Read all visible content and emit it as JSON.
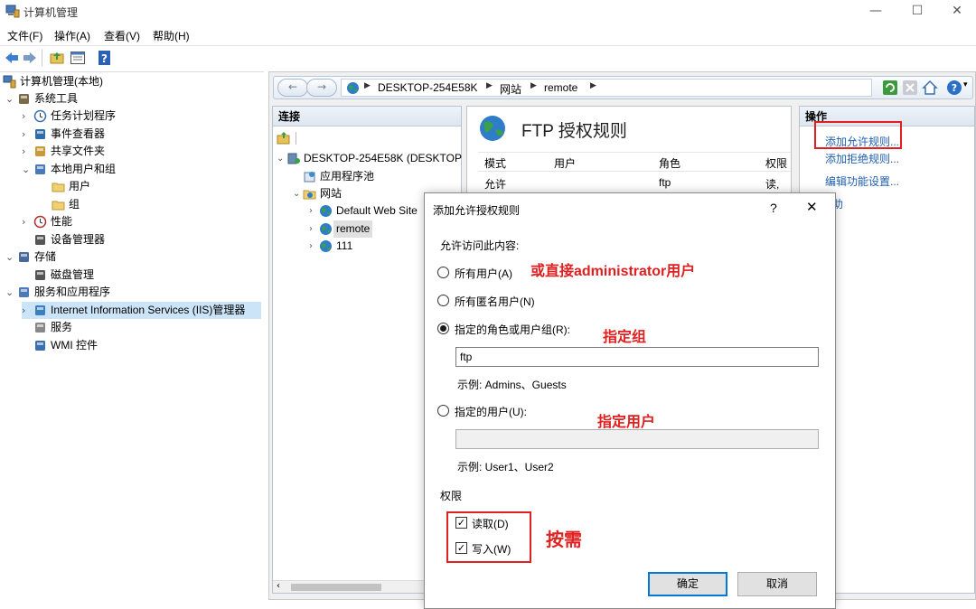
{
  "window": {
    "title": "计算机管理",
    "minimize": "—",
    "maximize": "☐",
    "close": "✕"
  },
  "menu": [
    "文件(F)",
    "操作(A)",
    "查看(V)",
    "帮助(H)"
  ],
  "toolbar_icons": [
    "back-arrow-icon",
    "forward-arrow-icon",
    "folder-up-icon",
    "properties-icon",
    "help-icon"
  ],
  "left_tree": {
    "root": "计算机管理(本地)",
    "items": [
      {
        "label": "系统工具",
        "icon": "tools-icon",
        "caret": "⌄"
      },
      {
        "label": "任务计划程序",
        "icon": "clock-icon",
        "caret": "›"
      },
      {
        "label": "事件查看器",
        "icon": "event-viewer-icon",
        "caret": "›"
      },
      {
        "label": "共享文件夹",
        "icon": "shared-folder-icon",
        "caret": "›"
      },
      {
        "label": "本地用户和组",
        "icon": "users-icon",
        "caret": "⌄"
      },
      {
        "label": "用户",
        "icon": "folder-icon",
        "caret": ""
      },
      {
        "label": "组",
        "icon": "folder-icon",
        "caret": ""
      },
      {
        "label": "性能",
        "icon": "performance-icon",
        "caret": "›"
      },
      {
        "label": "设备管理器",
        "icon": "device-manager-icon",
        "caret": ""
      },
      {
        "label": "存储",
        "icon": "storage-icon",
        "caret": "⌄"
      },
      {
        "label": "磁盘管理",
        "icon": "disk-icon",
        "caret": ""
      },
      {
        "label": "服务和应用程序",
        "icon": "services-apps-icon",
        "caret": "⌄"
      },
      {
        "label": "Internet Information Services (IIS)管理器",
        "icon": "iis-icon",
        "caret": "›"
      },
      {
        "label": "服务",
        "icon": "gear-icon",
        "caret": ""
      },
      {
        "label": "WMI 控件",
        "icon": "wmi-icon",
        "caret": ""
      }
    ]
  },
  "iis": {
    "address": {
      "back": "←",
      "forward": "→",
      "crumbs": [
        "DESKTOP-254E58K",
        "网站",
        "remote"
      ],
      "sep": "▶"
    },
    "connections": {
      "header": "连接",
      "tree": [
        {
          "label": "DESKTOP-254E58K (DESKTOP",
          "caret": "⌄",
          "icon": "server-icon"
        },
        {
          "label": "应用程序池",
          "caret": "",
          "icon": "app-pool-icon"
        },
        {
          "label": "网站",
          "caret": "⌄",
          "icon": "sites-folder-icon"
        },
        {
          "label": "Default Web Site",
          "caret": "›",
          "icon": "globe-icon"
        },
        {
          "label": "remote",
          "caret": "›",
          "icon": "globe-icon"
        },
        {
          "label": "111",
          "caret": "›",
          "icon": "globe-icon"
        }
      ]
    },
    "feature": {
      "title": "FTP 授权规则",
      "columns": [
        "模式",
        "用户",
        "角色",
        "权限"
      ],
      "rows": [
        {
          "mode": "允许",
          "user": "",
          "role": "ftp",
          "perm": "读,"
        }
      ]
    },
    "actions": {
      "header": "操作",
      "links": [
        "添加允许规则...",
        "添加拒绝规则...",
        "编辑功能设置...",
        "帮助"
      ]
    }
  },
  "dialog": {
    "title": "添加允许授权规则",
    "help": "?",
    "close": "✕",
    "prompt": "允许访问此内容:",
    "options": [
      {
        "label": "所有用户(A)",
        "checked": false
      },
      {
        "label": "所有匿名用户(N)",
        "checked": false
      },
      {
        "label": "指定的角色或用户组(R):",
        "checked": true
      },
      {
        "label": "指定的用户(U):",
        "checked": false
      }
    ],
    "role_value": "ftp",
    "role_example": "示例: Admins、Guests",
    "user_value": "",
    "user_example": "示例: User1、User2",
    "permissions_label": "权限",
    "permissions": [
      {
        "label": "读取(D)",
        "checked": true
      },
      {
        "label": "写入(W)",
        "checked": true
      }
    ],
    "ok": "确定",
    "cancel": "取消"
  },
  "annotations": {
    "all_users": "或直接administrator用户",
    "group": "指定组",
    "user": "指定用户",
    "permissions": "按需"
  },
  "colors": {
    "annotation_red": "#e02020",
    "link_blue": "#1f5fae",
    "focus_blue": "#0078d7"
  }
}
